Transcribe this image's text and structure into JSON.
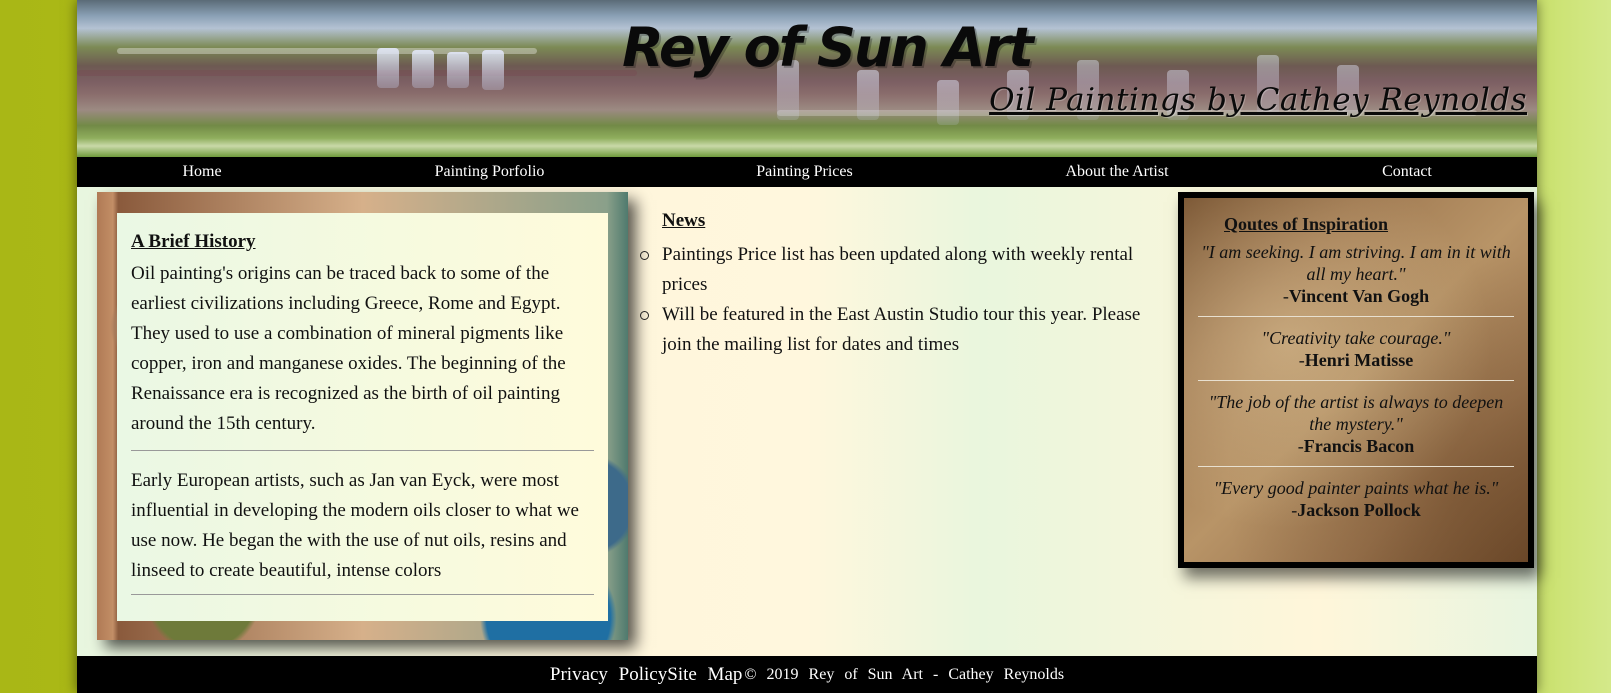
{
  "header": {
    "title": "Rey of Sun Art",
    "subtitle": "Oil Paintings by Cathey Reynolds"
  },
  "nav": {
    "items": [
      {
        "label": "Home"
      },
      {
        "label": "Painting Porfolio"
      },
      {
        "label": "Painting Prices"
      },
      {
        "label": "About the Artist"
      },
      {
        "label": "Contact"
      }
    ]
  },
  "history": {
    "heading": "A Brief History",
    "paragraphs": [
      "Oil painting's origins can be traced back to some of the earliest civilizations including Greece, Rome and Egypt. They used to use a combination of mineral pigments like copper, iron and manganese oxides. The beginning of the Renaissance era is recognized as the birth of oil painting around the 15th century.",
      "Early European artists, such as Jan van Eyck, were most influential in developing the modern oils closer to what we use now. He began the with the use of nut oils, resins and linseed to create beautiful, intense colors"
    ]
  },
  "news": {
    "heading": "News",
    "items": [
      "Paintings Price list has been updated along with weekly rental prices",
      "Will be featured in the East Austin Studio tour this year. Please join the mailing list for dates and times"
    ]
  },
  "quotes": {
    "heading": "Qoutes of Inspiration",
    "items": [
      {
        "quote": "\"I am seeking. I am striving. I am in it with all my heart.\"",
        "author": "Vincent Van Gogh"
      },
      {
        "quote": "\"Creativity take courage.\"",
        "author": "Henri Matisse"
      },
      {
        "quote": "\"The job of the artist is always to deepen the mystery.\"",
        "author": "Francis Bacon"
      },
      {
        "quote": "\"Every good painter paints what he is.\"",
        "author": "Jackson Pollock"
      }
    ],
    "author_prefix": "-"
  },
  "footer": {
    "privacy": "Privacy Policy",
    "sitemap": "Site Map",
    "copyright": "© 2019 Rey of Sun Art - Cathey Reynolds"
  }
}
